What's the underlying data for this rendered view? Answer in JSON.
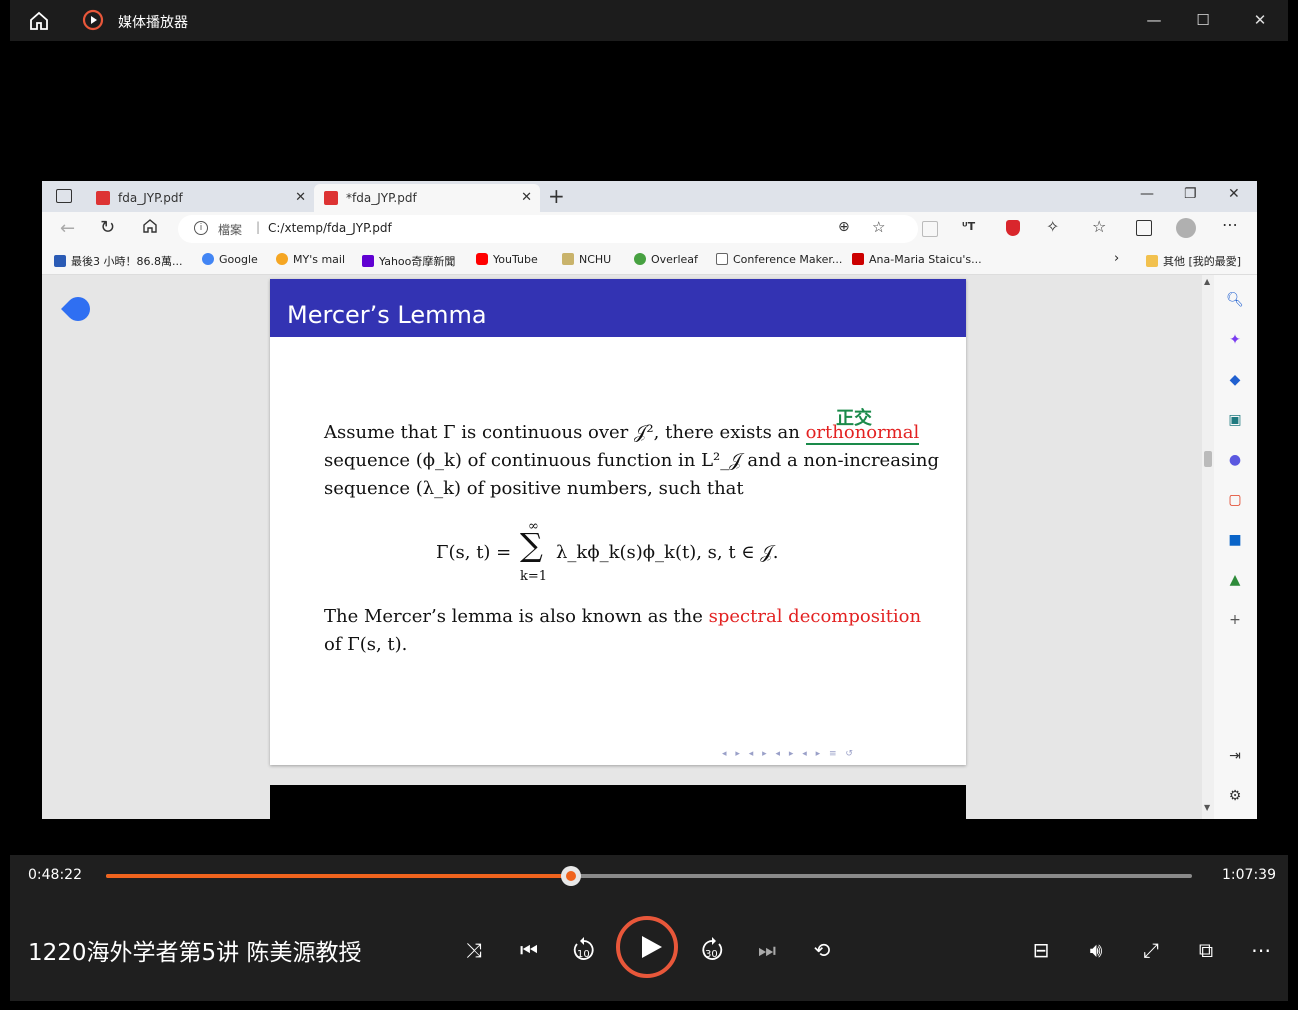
{
  "player": {
    "title": "媒体播放器",
    "current_time": "0:48:22",
    "total_time": "1:07:39",
    "progress": 0.4285,
    "media_title": "1220海外学者第5讲 陈美源教授",
    "accent": "#f0641e",
    "skip_back_label": "10",
    "skip_forward_label": "30"
  },
  "browser": {
    "tabs": [
      {
        "label": "fda_JYP.pdf",
        "active": false
      },
      {
        "label": "*fda_JYP.pdf",
        "active": true
      }
    ],
    "address_prefix": "檔案",
    "address": "C:/xtemp/fda_JYP.pdf",
    "bookmarks": [
      {
        "label": "最後3 小時！86.8萬...",
        "color": "#2b5bb5"
      },
      {
        "label": "Google",
        "color": "#4285f4"
      },
      {
        "label": "MY's mail",
        "color": "#f5a623"
      },
      {
        "label": "Yahoo奇摩新聞",
        "color": "#6001d2"
      },
      {
        "label": "YouTube",
        "color": "#ff0000"
      },
      {
        "label": "NCHU",
        "color": "#c9b36b"
      },
      {
        "label": "Overleaf",
        "color": "#47a141"
      },
      {
        "label": "Conference Maker...",
        "color": "#888888"
      },
      {
        "label": "Ana-Maria Staicu's...",
        "color": "#cc0000"
      }
    ],
    "other_bookmarks": "其他 [我的最愛]"
  },
  "slide": {
    "title": "Mercer’s Lemma",
    "para1_line1_a": "Assume that Γ is continuous over 𝒥², there exists an",
    "para1_line1_red": "orthonormal",
    "para1_line2": "sequence (ϕ_k) of continuous function in L²_𝒥 and a non-increasing",
    "para1_line3": "sequence (λ_k) of positive numbers, such that",
    "eq_lhs": "Γ(s, t) =",
    "eq_sum_top": "∞",
    "eq_sum": "∑",
    "eq_sum_bottom": "k=1",
    "eq_rhs": "λ_kϕ_k(s)ϕ_k(t), s, t ∈ 𝒥.",
    "annotation": "正交",
    "para2_line1_a": "The Mercer’s lemma is also known as the",
    "para2_line1_red": "spectral decomposition",
    "para2_line2": "of Γ(s, t)."
  }
}
